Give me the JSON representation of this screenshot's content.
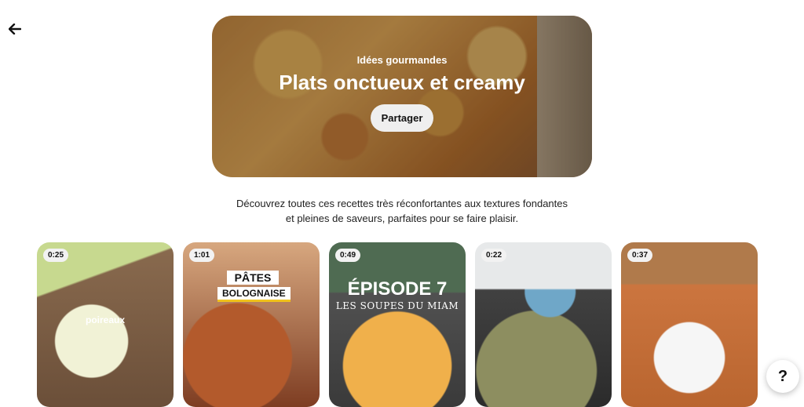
{
  "hero": {
    "eyebrow": "Idées gourmandes",
    "title": "Plats onctueux et creamy",
    "share_label": "Partager"
  },
  "description": {
    "line1": "Découvrez toutes ces recettes très réconfortantes aux textures fondantes",
    "line2": "et pleines de saveurs, parfaites pour se faire plaisir."
  },
  "cards": [
    {
      "duration": "0:25",
      "overlay": "poireaux"
    },
    {
      "duration": "1:01",
      "overlay_title": "PÂTES",
      "overlay_sub": "BOLOGNAISE"
    },
    {
      "duration": "0:49",
      "overlay_title": "ÉPISODE 7",
      "overlay_sub": "LES SOUPES DU MIAM"
    },
    {
      "duration": "0:22"
    },
    {
      "duration": "0:37"
    }
  ],
  "help": {
    "label": "?"
  },
  "icons": {
    "back": "arrow-left-icon"
  }
}
